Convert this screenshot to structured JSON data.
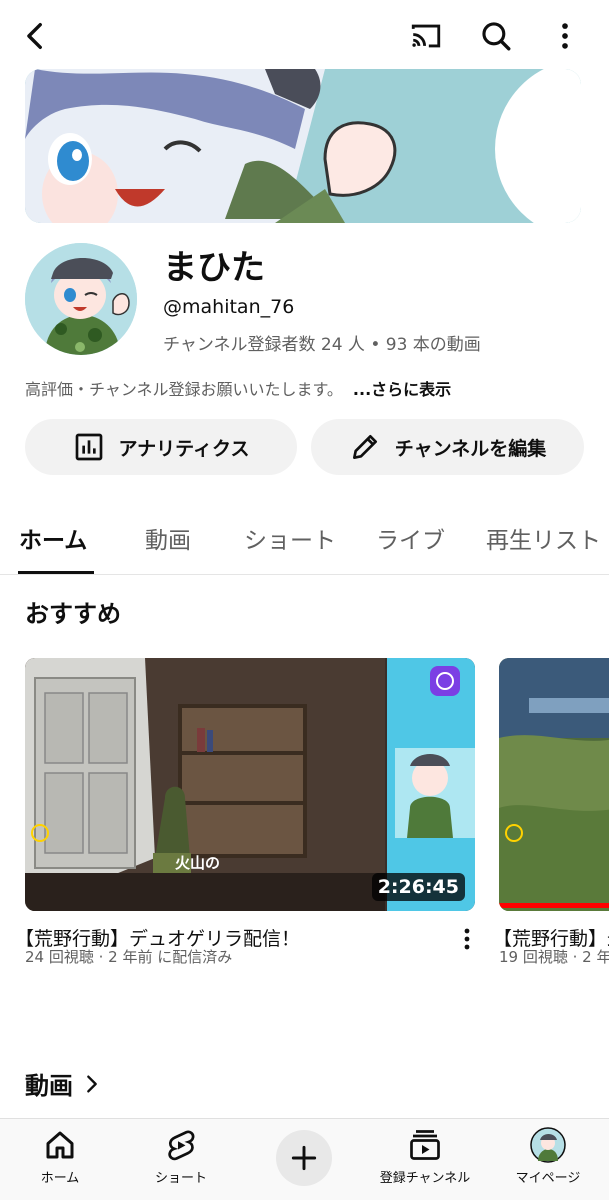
{
  "topbar": {
    "back_icon": "back-arrow-icon",
    "cast_icon": "cast-icon",
    "search_icon": "search-icon",
    "menu_icon": "more-vert-icon"
  },
  "channel": {
    "name": "まひた",
    "handle": "@mahitan_76",
    "meta": "チャンネル登録者数 24 人 • 93 本の動画",
    "description": "高評価・チャンネル登録お願いいたします。",
    "more": "...さらに表示"
  },
  "buttons": {
    "analytics": "アナリティクス",
    "edit": "チャンネルを編集"
  },
  "tabs": [
    "ホーム",
    "動画",
    "ショート",
    "ライブ",
    "再生リスト"
  ],
  "sections": {
    "recommended": "おすすめ",
    "videos": "動画"
  },
  "videos": [
    {
      "title": "【荒野行動】デュオゲリラ配信！",
      "meta": "24 回視聴 · 2 年前 に配信済み",
      "duration": "2:26:45",
      "overlay_text": "火山の"
    },
    {
      "title": "【荒野行動】最",
      "meta": "19 回視聴 · 2 年"
    }
  ],
  "bottom_nav": {
    "home": "ホーム",
    "shorts": "ショート",
    "subscriptions": "登録チャンネル",
    "mypage": "マイページ"
  },
  "colors": {
    "accent": "#ff0000",
    "text": "#0f0f0f",
    "secondary": "#606060",
    "chip": "#f2f2f2"
  }
}
